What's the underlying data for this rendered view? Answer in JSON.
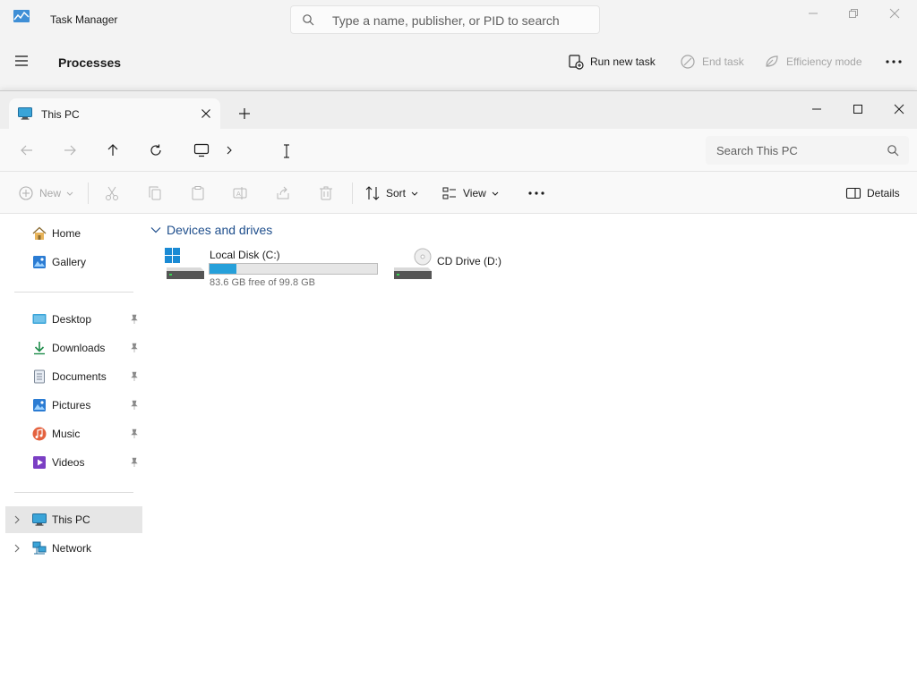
{
  "task_manager": {
    "title": "Task Manager",
    "search_placeholder": "Type a name, publisher, or PID to search",
    "page_title": "Processes",
    "commands": {
      "run_new_task": "Run new task",
      "end_task": "End task",
      "efficiency_mode": "Efficiency mode"
    },
    "icons": [
      "task-manager-app-icon",
      "search-icon",
      "minimize-icon",
      "restore-icon",
      "close-icon",
      "hamburger-menu-icon",
      "run-new-task-icon",
      "end-task-icon",
      "efficiency-mode-icon",
      "more-options-icon"
    ]
  },
  "explorer": {
    "tab": {
      "label": "This PC"
    },
    "address": {
      "path_segments": [
        "This PC"
      ]
    },
    "search": {
      "placeholder": "Search This PC"
    },
    "toolbar": {
      "new_label": "New",
      "sort_label": "Sort",
      "view_label": "View",
      "details_label": "Details"
    },
    "nav": {
      "top": [
        {
          "label": "Home",
          "icon": "home-icon"
        },
        {
          "label": "Gallery",
          "icon": "gallery-icon"
        }
      ],
      "quick_access": [
        {
          "label": "Desktop",
          "icon": "desktop-folder-icon",
          "pinned": true
        },
        {
          "label": "Downloads",
          "icon": "downloads-folder-icon",
          "pinned": true
        },
        {
          "label": "Documents",
          "icon": "documents-folder-icon",
          "pinned": true
        },
        {
          "label": "Pictures",
          "icon": "pictures-folder-icon",
          "pinned": true
        },
        {
          "label": "Music",
          "icon": "music-folder-icon",
          "pinned": true
        },
        {
          "label": "Videos",
          "icon": "videos-folder-icon",
          "pinned": true
        }
      ],
      "locations": [
        {
          "label": "This PC",
          "icon": "this-pc-icon",
          "selected": true
        },
        {
          "label": "Network",
          "icon": "network-icon",
          "selected": false
        }
      ]
    },
    "content": {
      "group_title": "Devices and drives",
      "drives": [
        {
          "name": "Local Disk (C:)",
          "free_text": "83.6 GB free of 99.8 GB",
          "used_fraction": 0.162,
          "icon": "windows-drive-icon"
        },
        {
          "name": "CD Drive (D:)",
          "icon": "cd-drive-icon"
        }
      ]
    },
    "colors": {
      "accent": "#26a0da",
      "group_header": "#1e4e8c",
      "selected_nav": "#e6e6e6"
    }
  }
}
